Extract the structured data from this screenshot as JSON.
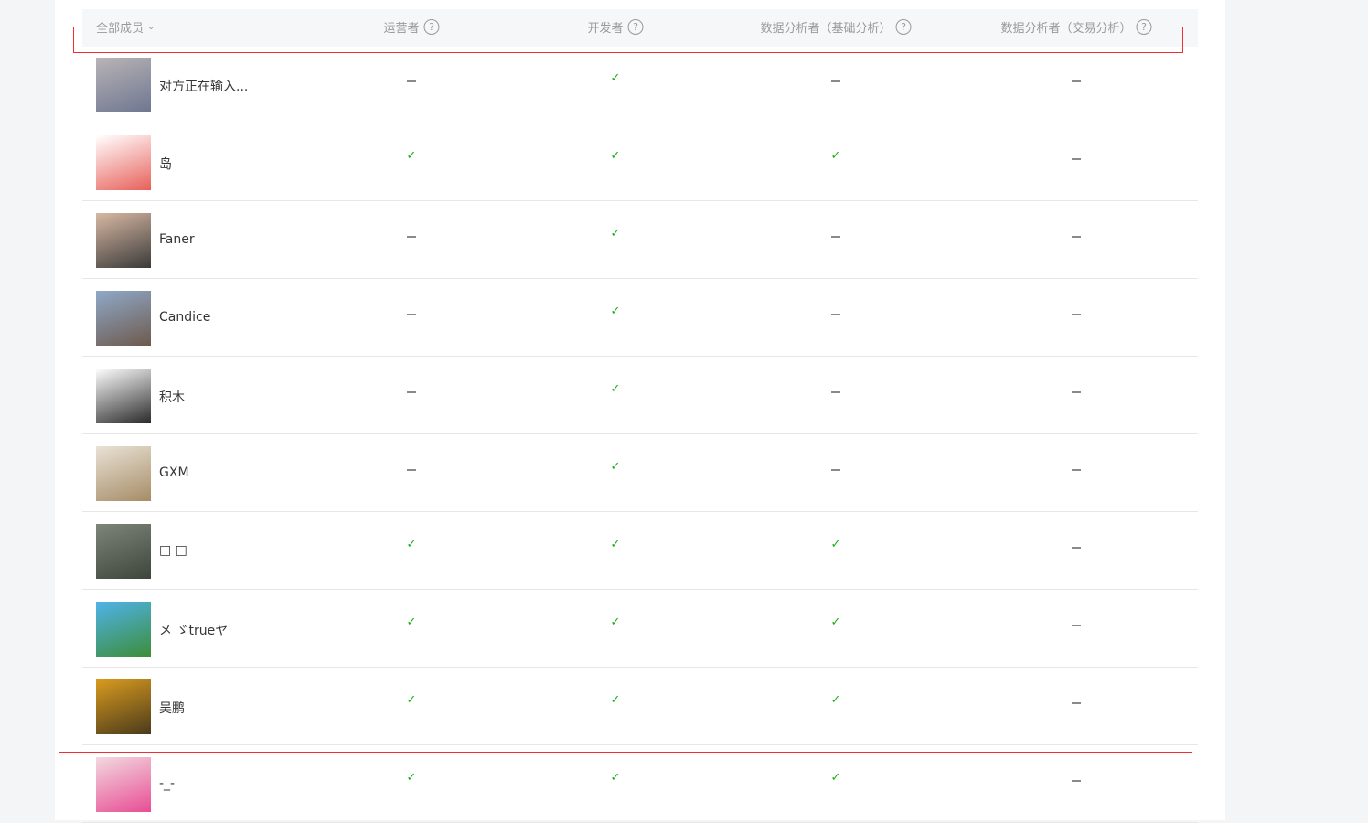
{
  "header": {
    "member_filter": "全部成员",
    "columns": [
      {
        "label": "运营者",
        "help": "?"
      },
      {
        "label": "开发者",
        "help": "?"
      },
      {
        "label": "数据分析者（基础分析）",
        "help": "?"
      },
      {
        "label": "数据分析者（交易分析）",
        "help": "?"
      }
    ]
  },
  "colors": {
    "check": "#1aad19",
    "annotation": "#f03030"
  },
  "members": [
    {
      "name": "对方正在输入...",
      "roles": [
        false,
        true,
        false,
        false
      ],
      "avatar": [
        "#b9b4b6",
        "#6e7690"
      ]
    },
    {
      "name": "岛",
      "roles": [
        true,
        true,
        true,
        false
      ],
      "avatar": [
        "#ffffff",
        "#e8605a"
      ]
    },
    {
      "name": "Faner",
      "roles": [
        false,
        true,
        false,
        false
      ],
      "avatar": [
        "#d8b8a3",
        "#3a3a3a"
      ]
    },
    {
      "name": "Candice",
      "roles": [
        false,
        true,
        false,
        false
      ],
      "avatar": [
        "#8fa9c8",
        "#6e5a4e"
      ]
    },
    {
      "name": "积木",
      "roles": [
        false,
        true,
        false,
        false
      ],
      "avatar": [
        "#ffffff",
        "#2a2a2a"
      ]
    },
    {
      "name": "GXM",
      "roles": [
        false,
        true,
        false,
        false
      ],
      "avatar": [
        "#e9e2d6",
        "#a68c66"
      ]
    },
    {
      "name": "□ □",
      "roles": [
        true,
        true,
        true,
        false
      ],
      "avatar": [
        "#7d8478",
        "#3e463c"
      ]
    },
    {
      "name": "メ ゞtrueヤ",
      "roles": [
        true,
        true,
        true,
        false
      ],
      "avatar": [
        "#4fb3ea",
        "#3d8d3a"
      ]
    },
    {
      "name": "吴鹏",
      "roles": [
        true,
        true,
        true,
        false
      ],
      "avatar": [
        "#d99b1e",
        "#4a3a1c"
      ]
    },
    {
      "name": "-_-",
      "roles": [
        true,
        true,
        true,
        false
      ],
      "avatar": [
        "#f2d9df",
        "#e84d94"
      ]
    }
  ]
}
